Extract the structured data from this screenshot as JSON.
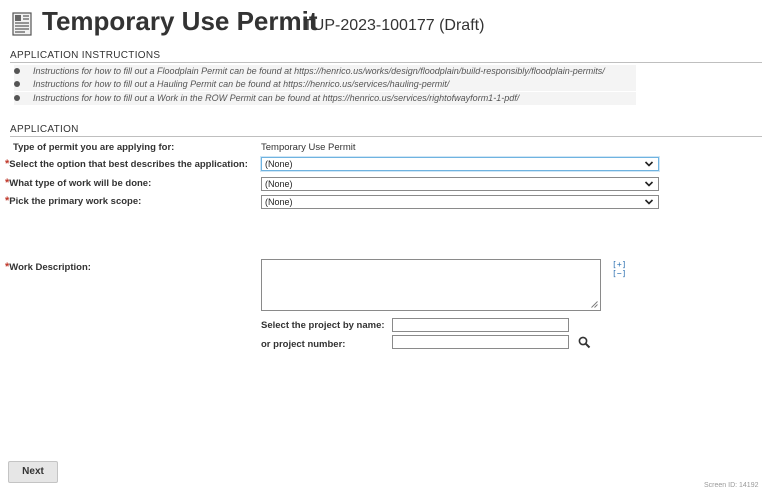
{
  "header": {
    "title": "Temporary Use Permit",
    "record_id": "TUP-2023-100177 (Draft)",
    "icon": "document-icon"
  },
  "instructions_section": {
    "title": "APPLICATION INSTRUCTIONS",
    "items": [
      "Instructions for how to fill out a Floodplain Permit can be found at https://henrico.us/works/design/floodplain/build-responsibly/floodplain-permits/",
      "Instructions for how to fill out a Hauling Permit can be found at https://henrico.us/services/hauling-permit/",
      "Instructions for how to fill out a Work in the ROW Permit can be found at https://henrico.us/services/rightofwayform1-1-pdf/"
    ]
  },
  "application_section": {
    "title": "APPLICATION",
    "permit_type_label": "Type of permit you are applying for:",
    "permit_type_value": "Temporary Use Permit",
    "required_marker": "*",
    "option_label": "Select the option that best describes the application:",
    "option_value": "(None)",
    "work_type_label": "What type of work will be done:",
    "work_type_value": "(None)",
    "work_scope_label": "Pick the primary work scope:",
    "work_scope_value": "(None)",
    "work_description_label": "Work Description:",
    "work_description_value": "",
    "expand_toggle": "[+]\n[−]",
    "project_name_label": "Select the project by name:",
    "project_name_value": "",
    "project_number_label": "or project number:",
    "project_number_value": ""
  },
  "footer": {
    "next_label": "Next",
    "screen_id": "Screen ID: 14192"
  },
  "colors": {
    "required": "#c0392b",
    "focus_border": "#6fb3e0",
    "link_blue": "#2a6fb0"
  }
}
